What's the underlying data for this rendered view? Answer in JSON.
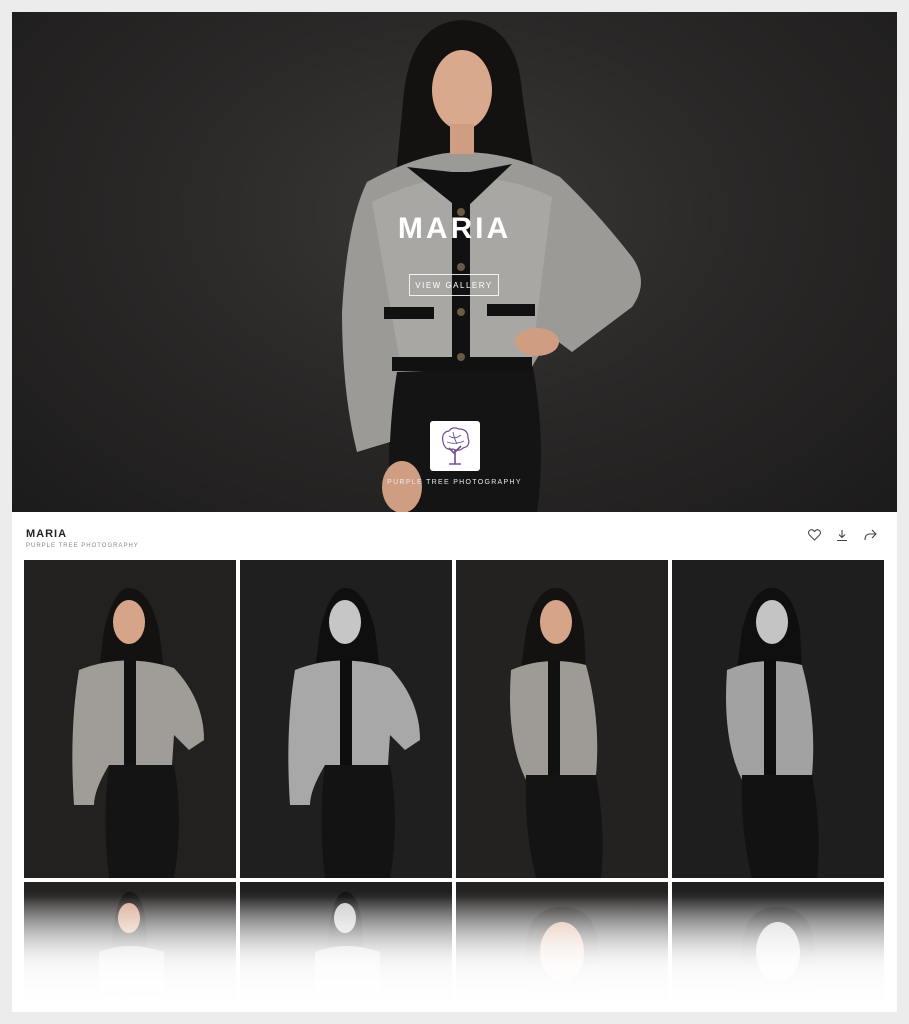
{
  "hero": {
    "title": "MARIA",
    "button_label": "VIEW GALLERY",
    "studio": "PURPLE TREE PHOTOGRAPHY"
  },
  "gallery": {
    "title": "MARIA",
    "subtitle": "PURPLE TREE PHOTOGRAPHY",
    "icons": [
      "heart-icon",
      "download-icon",
      "share-icon"
    ]
  },
  "colors": {
    "hero_bg": "#2b2928",
    "logo_purple": "#6d4d8f",
    "text_dark": "#222222"
  },
  "photos": [
    {
      "tone": "color",
      "pose": "hand-on-hip"
    },
    {
      "tone": "bw",
      "pose": "hand-on-hip"
    },
    {
      "tone": "color",
      "pose": "leaning"
    },
    {
      "tone": "bw",
      "pose": "leaning"
    },
    {
      "tone": "color",
      "pose": "close-up"
    },
    {
      "tone": "bw",
      "pose": "close-up"
    },
    {
      "tone": "color",
      "pose": "smile-close-up"
    },
    {
      "tone": "bw",
      "pose": "smile-close-up"
    }
  ]
}
